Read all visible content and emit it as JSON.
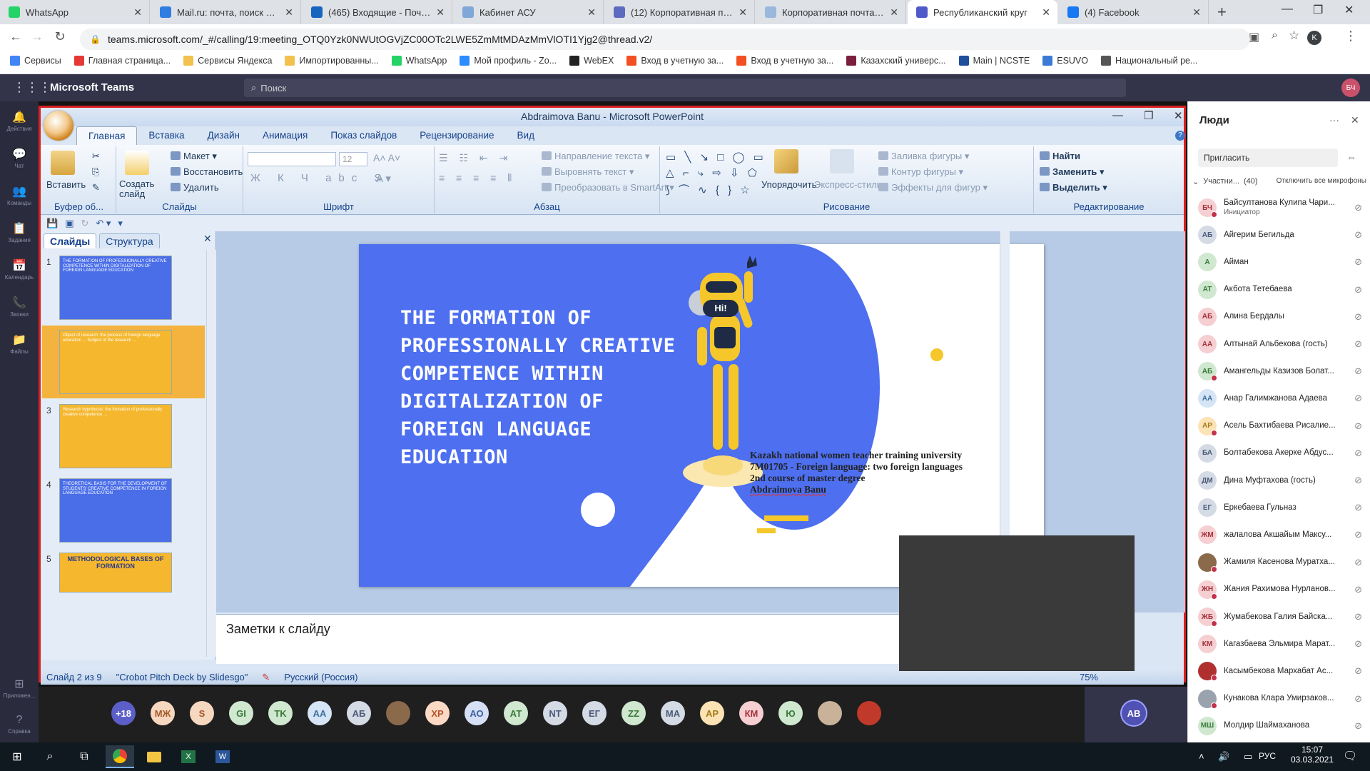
{
  "browser": {
    "tabs": [
      {
        "label": "WhatsApp",
        "color": "#25d366"
      },
      {
        "label": "Mail.ru: почта, поиск в инте",
        "color": "#2f7de1"
      },
      {
        "label": "(465) Входящие - Почта Mail.",
        "color": "#1565c0"
      },
      {
        "label": "Кабинет АСУ",
        "color": "#7fa7d8"
      },
      {
        "label": "(12) Корпоративная почта",
        "color": "#5c6bc0"
      },
      {
        "label": "Корпоративная почта :: TM",
        "color": "#9ab8dc"
      },
      {
        "label": "Республиканский круг",
        "color": "#5059c9"
      },
      {
        "label": "(4) Facebook",
        "color": "#1877f2"
      }
    ],
    "url": "teams.microsoft.com/_#/calling/19:meeting_OTQ0Yzk0NWUtOGVjZC00OTc2LWE5ZmMtMDAzMmVlOTI1Yjg2@thread.v2/",
    "profile_initial": "K",
    "bookmarks": [
      {
        "label": "Сервисы",
        "color": "#4285f4"
      },
      {
        "label": "Главная страница...",
        "color": "#e53935"
      },
      {
        "label": "Сервисы Яндекса",
        "color": "#f2c14e"
      },
      {
        "label": "Импортированны...",
        "color": "#f2c14e"
      },
      {
        "label": "WhatsApp",
        "color": "#25d366"
      },
      {
        "label": "Мой профиль - Zo...",
        "color": "#2d8cff"
      },
      {
        "label": "WebEX",
        "color": "#222"
      },
      {
        "label": "Вход в учетную за...",
        "color": "#f25022"
      },
      {
        "label": "Вход в учетную за...",
        "color": "#f25022"
      },
      {
        "label": "Казахский универс...",
        "color": "#7a1f3d"
      },
      {
        "label": "Main | NCSTE",
        "color": "#1e4e9c"
      },
      {
        "label": "ESUVO",
        "color": "#3b7bd6"
      },
      {
        "label": "Национальный ре...",
        "color": "#555"
      }
    ]
  },
  "teams": {
    "app_name": "Microsoft Teams",
    "search_placeholder": "Поиск",
    "user_initials": "БЧ",
    "rail": [
      "Действия",
      "Чат",
      "Команды",
      "Задания",
      "Календарь",
      "Звонки",
      "Файлы",
      "Приложен...",
      "Справка"
    ]
  },
  "ppt": {
    "window_title": "Abdraimova Banu - Microsoft PowerPoint",
    "tabs": [
      "Главная",
      "Вставка",
      "Дизайн",
      "Анимация",
      "Показ слайдов",
      "Рецензирование",
      "Вид"
    ],
    "active_tab": "Главная",
    "groups": {
      "clipboard": {
        "label": "Буфер об...",
        "paste": "Вставить"
      },
      "slides": {
        "label": "Слайды",
        "new_slide": "Создать слайд",
        "layout": "Макет",
        "reset": "Восстановить",
        "delete": "Удалить"
      },
      "font": {
        "label": "Шрифт",
        "size": "12"
      },
      "paragraph": {
        "label": "Абзац",
        "text_direction": "Направление текста",
        "align_text": "Выровнять текст",
        "smartart": "Преобразовать в SmartArt"
      },
      "drawing": {
        "label": "Рисование",
        "arrange": "Упорядочить",
        "quick_styles": "Экспресс-стили",
        "fill": "Заливка фигуры",
        "outline": "Контур фигуры",
        "effects": "Эффекты для фигур"
      },
      "editing": {
        "label": "Редактирование",
        "find": "Найти",
        "replace": "Заменить",
        "select": "Выделить"
      }
    },
    "pane_tabs": [
      "Слайды",
      "Структура"
    ],
    "thumbnails": [
      {
        "num": "1",
        "text": "THE FORMATION OF PROFESSIONALLY CREATIVE COMPETENCE WITHIN DIGITALIZATION OF FOREIGN LANGUAGE EDUCATION",
        "bg": "#4a6ee8"
      },
      {
        "num": "2",
        "text": "Object of research: the process of foreign language education ... Subject of the research ...",
        "bg": "#f5b72d"
      },
      {
        "num": "3",
        "text": "Research hypothesis: the formation of professionally creative competence ...",
        "bg": "#f5b72d"
      },
      {
        "num": "4",
        "text": "THEORETICAL BASIS FOR THE DEVELOPMENT OF STUDENTS' CREATIVE COMPETENCE IN FOREIGN LANGUAGE EDUCATION",
        "bg": "#4a6ee8"
      },
      {
        "num": "5",
        "text": "METHODOLOGICAL BASES OF FORMATION",
        "bg": "#f5b72d"
      }
    ],
    "slide": {
      "title": "THE FORMATION OF PROFESSIONALLY CREATIVE COMPETENCE WITHIN DIGITALIZATION OF FOREIGN LANGUAGE EDUCATION",
      "robot_badge": "Hi!",
      "info": [
        "Kazakh national women teacher  training university",
        "7M01705 - Foreign  language: two foreign languages",
        "2nd course of master degree",
        "Abdraimova Banu"
      ]
    },
    "notes_placeholder": "Заметки к слайду",
    "status": {
      "slide_pos": "Слайд 2 из 9",
      "theme": "\"Crobot Pitch Deck by Slidesgo\"",
      "language": "Русский (Россия)",
      "zoom": "75%"
    }
  },
  "strip": [
    {
      "initials": "+18",
      "bg": "#5b5fc7",
      "fg": "#fff"
    },
    {
      "initials": "МЖ",
      "bg": "#f6d7c0",
      "fg": "#a55a2a"
    },
    {
      "initials": "S",
      "bg": "#f6d7c0",
      "fg": "#a55a2a"
    },
    {
      "initials": "GI",
      "bg": "#cfe8cf",
      "fg": "#3a7a3a"
    },
    {
      "initials": "TK",
      "bg": "#cfe8cf",
      "fg": "#3a7a3a"
    },
    {
      "initials": "AA",
      "bg": "#d5e5f5",
      "fg": "#3f6e9e"
    },
    {
      "initials": "АБ",
      "bg": "#d5dbe5",
      "fg": "#4a5a78"
    },
    {
      "initials": "",
      "bg": "#8a6a4a",
      "fg": "#fff"
    },
    {
      "initials": "ХР",
      "bg": "#fbd9c4",
      "fg": "#b5552a"
    },
    {
      "initials": "АО",
      "bg": "#d5e0f5",
      "fg": "#3f5e9e"
    },
    {
      "initials": "АТ",
      "bg": "#cfe8cf",
      "fg": "#3a7a3a"
    },
    {
      "initials": "NT",
      "bg": "#d5dbe5",
      "fg": "#4a5a78"
    },
    {
      "initials": "ЕГ",
      "bg": "#d5dbe5",
      "fg": "#4a5a78"
    },
    {
      "initials": "ZZ",
      "bg": "#cfe8cf",
      "fg": "#3a7a3a"
    },
    {
      "initials": "МА",
      "bg": "#d5dbe5",
      "fg": "#4a5a78"
    },
    {
      "initials": "АР",
      "bg": "#fbe3b5",
      "fg": "#a57a1a"
    },
    {
      "initials": "КМ",
      "bg": "#f5cfd2",
      "fg": "#a5333a"
    },
    {
      "initials": "Ю",
      "bg": "#cfe8cf",
      "fg": "#3a7a3a"
    },
    {
      "initials": "",
      "bg": "#c8b39a",
      "fg": "#fff"
    },
    {
      "initials": "",
      "bg": "#c0392b",
      "fg": "#fff"
    }
  ],
  "self_initials": "AB",
  "people": {
    "title": "Люди",
    "invite": "Пригласить",
    "section": "Участни...",
    "count": "(40)",
    "mute_all": "Отключить все микрофоны",
    "list": [
      {
        "initials": "БЧ",
        "name": "Байсултанова Кулипа Чари...",
        "role": "Инициатор",
        "bg": "#f5cfd2",
        "fg": "#a5333a",
        "dot": true
      },
      {
        "initials": "АБ",
        "name": "Айгерим Бегильда",
        "role": "",
        "bg": "#d5dbe5",
        "fg": "#4a5a78",
        "dot": false
      },
      {
        "initials": "А",
        "name": "Айман",
        "role": "",
        "bg": "#cfe8cf",
        "fg": "#3a7a3a",
        "dot": false
      },
      {
        "initials": "АТ",
        "name": "Акбота Тетебаева",
        "role": "",
        "bg": "#cfe8cf",
        "fg": "#3a7a3a",
        "dot": false
      },
      {
        "initials": "АБ",
        "name": "Алина Бердалы",
        "role": "",
        "bg": "#f5cfd2",
        "fg": "#a5333a",
        "dot": false
      },
      {
        "initials": "АА",
        "name": "Алтынай Альбекова (гость)",
        "role": "",
        "bg": "#f5cfd2",
        "fg": "#a5333a",
        "dot": false
      },
      {
        "initials": "АБ",
        "name": "Амангельды Казизов Болат...",
        "role": "",
        "bg": "#cfe8cf",
        "fg": "#3a7a3a",
        "dot": true
      },
      {
        "initials": "АА",
        "name": "Анар Галимжанова Адаева",
        "role": "",
        "bg": "#d5e5f5",
        "fg": "#3f6e9e",
        "dot": false
      },
      {
        "initials": "АР",
        "name": "Асель Бахтибаева Рисалие...",
        "role": "",
        "bg": "#fbe3b5",
        "fg": "#a57a1a",
        "dot": true
      },
      {
        "initials": "БА",
        "name": "Болтабекова Акерке Абдус...",
        "role": "",
        "bg": "#d5dbe5",
        "fg": "#4a5a78",
        "dot": false
      },
      {
        "initials": "ДМ",
        "name": "Дина Муфтахова (гость)",
        "role": "",
        "bg": "#d5dbe5",
        "fg": "#4a5a78",
        "dot": false
      },
      {
        "initials": "ЕГ",
        "name": "Еркебаева Гульназ",
        "role": "",
        "bg": "#d5dbe5",
        "fg": "#4a5a78",
        "dot": false
      },
      {
        "initials": "ЖМ",
        "name": "жалалова Акшайым Максу...",
        "role": "",
        "bg": "#f5cfd2",
        "fg": "#a5333a",
        "dot": false
      },
      {
        "initials": "",
        "name": "Жамиля Касенова Муратха...",
        "role": "",
        "bg": "#8a6a4a",
        "fg": "#fff",
        "dot": true
      },
      {
        "initials": "ЖН",
        "name": "Жания Рахимова Нурланов...",
        "role": "",
        "bg": "#f5cfd2",
        "fg": "#a5333a",
        "dot": true
      },
      {
        "initials": "ЖБ",
        "name": "Жумабекова Галия Байска...",
        "role": "",
        "bg": "#f5cfd2",
        "fg": "#a5333a",
        "dot": true
      },
      {
        "initials": "КМ",
        "name": "Кагазбаева Эльмира Марат...",
        "role": "",
        "bg": "#f5cfd2",
        "fg": "#a5333a",
        "dot": false
      },
      {
        "initials": "",
        "name": "Касымбекова Мархабат Ас...",
        "role": "",
        "bg": "#b03030",
        "fg": "#fff",
        "dot": true
      },
      {
        "initials": "",
        "name": "Кунакова Клара Умирзаков...",
        "role": "",
        "bg": "#9aa3ad",
        "fg": "#fff",
        "dot": true
      },
      {
        "initials": "МШ",
        "name": "Молдир Шаймаханова",
        "role": "",
        "bg": "#cfe8cf",
        "fg": "#3a7a3a",
        "dot": false
      }
    ]
  },
  "taskbar": {
    "time": "15:07",
    "date": "03.03.2021",
    "lang": "РУС"
  }
}
